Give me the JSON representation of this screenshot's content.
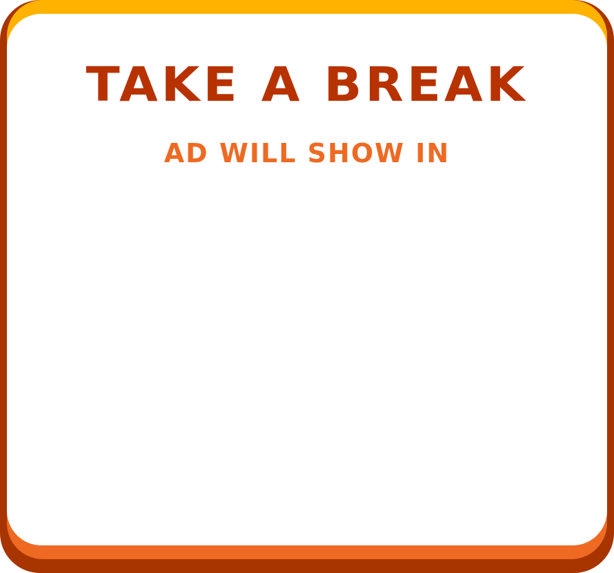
{
  "dialog": {
    "title": "TAKE A BREAK",
    "subtitle": "AD WILL SHOW IN"
  },
  "colors": {
    "frame_dark": "#a83400",
    "frame_orange": "#ee6a23",
    "frame_top_yellow": "#ffb200",
    "panel_bg": "#ffffff",
    "title_color": "#b83200",
    "subtitle_color": "#ee6a23"
  }
}
